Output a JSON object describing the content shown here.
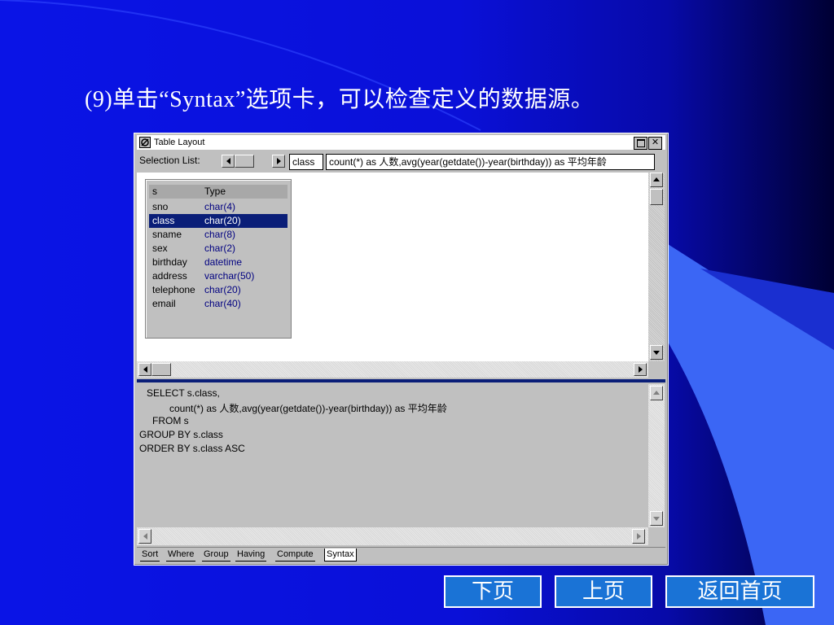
{
  "slide": {
    "title": "(9)单击“Syntax”选项卡，可以检查定义的数据源。"
  },
  "window": {
    "title": "Table Layout",
    "selection_label": "Selection List:",
    "selection_items": [
      "class",
      "count(*) as 人数,avg(year(getdate())-year(birthday)) as 平均年龄"
    ]
  },
  "table": {
    "name": "s",
    "type_header": "Type",
    "columns": [
      {
        "name": "sno",
        "type": "char(4)"
      },
      {
        "name": "class",
        "type": "char(20)"
      },
      {
        "name": "sname",
        "type": "char(8)"
      },
      {
        "name": "sex",
        "type": "char(2)"
      },
      {
        "name": "birthday",
        "type": "datetime"
      },
      {
        "name": "address",
        "type": "varchar(50)"
      },
      {
        "name": "telephone",
        "type": "char(20)"
      },
      {
        "name": "email",
        "type": "char(40)"
      }
    ],
    "selected": "class"
  },
  "sql": {
    "lines": [
      "SELECT s.class,",
      "count(*) as 人数,avg(year(getdate())-year(birthday)) as 平均年龄",
      "FROM s",
      "GROUP BY s.class",
      "ORDER BY s.class ASC"
    ]
  },
  "tabs": [
    "Sort",
    "Where",
    "Group",
    "Having",
    "Compute",
    "Syntax"
  ],
  "active_tab": "Syntax",
  "nav": {
    "next": "下页",
    "prev": "上页",
    "home": "返回首页"
  },
  "colors": {
    "background": "#0a14e6",
    "accent_shape": "#3b66f5",
    "selection": "#0a1e78",
    "nav_button": "#1a73d6"
  }
}
